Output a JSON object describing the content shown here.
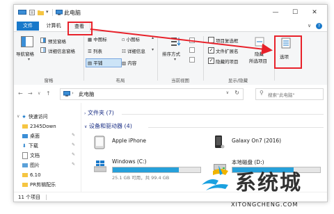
{
  "window": {
    "title": "此电脑",
    "controls": {
      "minimize": "—",
      "maximize": "☐",
      "close": "✕"
    }
  },
  "ribbon_tabs": {
    "file": "文件",
    "computer": "计算机",
    "view": "查看",
    "help": "?"
  },
  "ribbon": {
    "pane_group": {
      "nav_pane": "导航窗格",
      "preview_pane": "预览窗格",
      "details_pane": "详细信息窗格",
      "label": "窗格"
    },
    "layout_group": {
      "items": [
        "中图标",
        "小图标",
        "列表",
        "详细信息",
        "平铺",
        "内容"
      ],
      "label": "布局"
    },
    "current_view_group": {
      "sort_by": "排序方式",
      "label": "当前视图"
    },
    "show_hide_group": {
      "item_checkboxes": "项目复选框",
      "file_extensions": "文件扩展名",
      "hidden_items": "隐藏的项目",
      "hide_selected_1": "隐藏",
      "hide_selected_2": "所选项目",
      "label": "显示/隐藏",
      "item_checkboxes_checked": false,
      "file_extensions_checked": true,
      "hidden_items_checked": true
    },
    "options": "选项"
  },
  "address": {
    "path": "此电脑",
    "search_placeholder": "搜索\"此电脑\""
  },
  "nav_pane": {
    "items": [
      {
        "label": "快速访问",
        "icon": "star-icon"
      },
      {
        "label": "2345Down",
        "icon": "folder-icon"
      },
      {
        "label": "桌面",
        "icon": "desktop-folder-icon"
      },
      {
        "label": "下载",
        "icon": "download-folder-icon"
      },
      {
        "label": "文档",
        "icon": "documents-folder-icon"
      },
      {
        "label": "图片",
        "icon": "pictures-folder-icon"
      },
      {
        "label": "6.10",
        "icon": "folder-icon"
      },
      {
        "label": "PR剪辑配乐",
        "icon": "folder-icon"
      }
    ]
  },
  "main": {
    "folders_section": "文件夹 (7)",
    "devices_section": "设备和驱动器 (4)",
    "devices": [
      {
        "name": "Apple iPhone",
        "icon": "iphone-icon"
      },
      {
        "name": "Galaxy On7 (2016)",
        "icon": "android-phone-icon"
      },
      {
        "name": "Windows (C:)",
        "icon": "windows-drive-icon",
        "free_text": "25.1 GB 可用，共 99.4 GB",
        "used_fraction": 0.75
      },
      {
        "name": "本地磁盘 (D:)",
        "icon": "drive-icon",
        "free_text": "",
        "used_fraction": 0.7
      }
    ]
  },
  "status": {
    "count": "11 个项目"
  },
  "watermark": {
    "brand": "系统城",
    "url": "XITONGCHENG.COM"
  },
  "colors": {
    "accent": "#1979ca",
    "highlight_box": "#e8212a",
    "storage_bar": "#26a0da"
  }
}
